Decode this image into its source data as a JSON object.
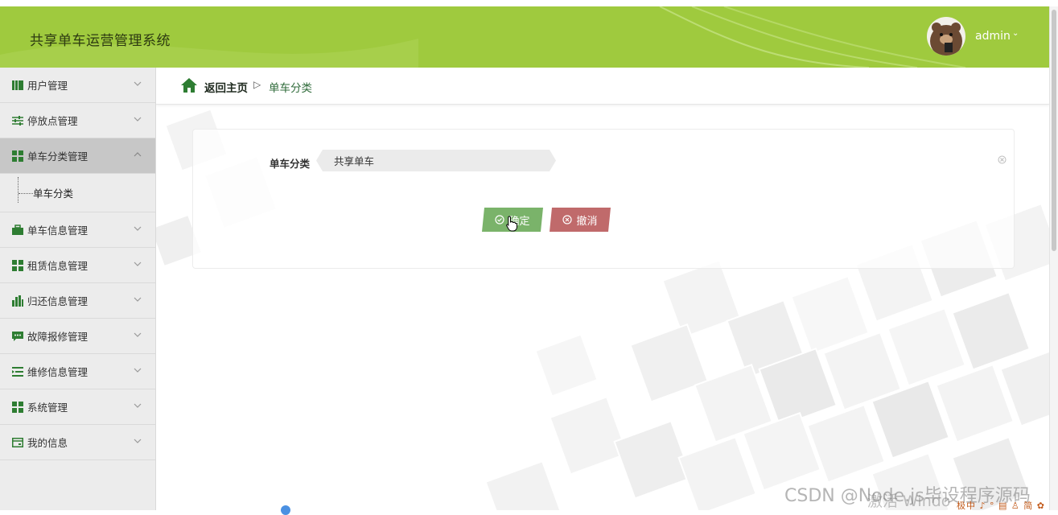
{
  "app": {
    "title": "共享单车运营管理系统"
  },
  "user": {
    "name": "admin",
    "caret": "⌄"
  },
  "sidebar": {
    "items": [
      {
        "label": "用户管理",
        "icon": "book-icon"
      },
      {
        "label": "停放点管理",
        "icon": "sliders-icon"
      },
      {
        "label": "单车分类管理",
        "icon": "grid-icon",
        "expanded": true
      },
      {
        "label": "单车信息管理",
        "icon": "briefcase-icon"
      },
      {
        "label": "租赁信息管理",
        "icon": "grid-icon"
      },
      {
        "label": "归还信息管理",
        "icon": "bar-chart-icon"
      },
      {
        "label": "故障报修管理",
        "icon": "comment-icon"
      },
      {
        "label": "维修信息管理",
        "icon": "list-indent-icon"
      },
      {
        "label": "系统管理",
        "icon": "grid-icon"
      },
      {
        "label": "我的信息",
        "icon": "card-icon"
      }
    ],
    "submenu": {
      "label": "单车分类"
    }
  },
  "breadcrumb": {
    "home": "返回主页",
    "separator": "▷",
    "current": "单车分类"
  },
  "form": {
    "field_label": "单车分类",
    "field_value": "共享单车",
    "confirm_label": "确定",
    "cancel_label": "撤消"
  },
  "overlay": {
    "watermark": "CSDN @Node.js毕设程序源码",
    "activate": "激活 Windo",
    "tray": "极中 ♪ ° ▤ ♙ 简 ✿"
  },
  "colors": {
    "header": "#9fca3e",
    "confirm": "#7ab36a",
    "cancel": "#c06a6b",
    "accent": "#2f6b3a"
  }
}
